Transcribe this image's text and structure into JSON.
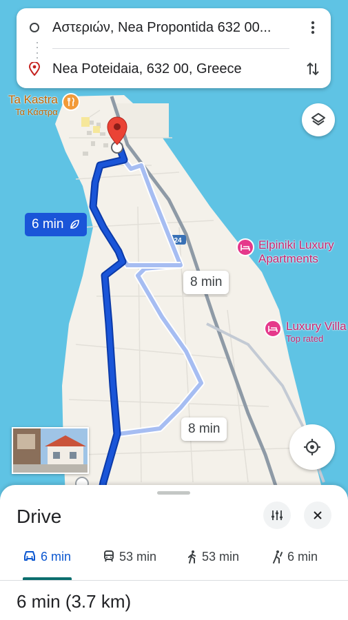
{
  "search": {
    "origin": "Αστεριών, Nea Propontida 632 00...",
    "destination": "Nea Poteidaia, 632 00, Greece"
  },
  "map": {
    "selected_route_time": "6 min",
    "alt_route_time_1": "8 min",
    "alt_route_time_2": "8 min",
    "road_number": "24",
    "poi_kastra_name": "Ta Kastra",
    "poi_kastra_sub": "Τα Κάστρα",
    "poi_elpiniki_line1": "Elpiniki Luxury",
    "poi_elpiniki_line2": "Apartments",
    "poi_luxury_name": "Luxury Villa",
    "poi_luxury_sub": "Top rated"
  },
  "sheet": {
    "title": "Drive",
    "tabs": [
      {
        "icon": "car-icon",
        "label": "6 min"
      },
      {
        "icon": "transit-icon",
        "label": "53 min"
      },
      {
        "icon": "walk-icon",
        "label": "53 min"
      },
      {
        "icon": "ride-icon",
        "label": "6 min"
      }
    ],
    "summary_time": "6 min",
    "summary_distance": "(3.7 km)"
  },
  "colors": {
    "water": "#5fc3e4",
    "land": "#f4f1ea",
    "route_selected": "#1a55d8",
    "route_alt": "#a6bdf2",
    "accent": "#0b57d0",
    "pin": "#ea4335",
    "poi_hotel": "#e5398b",
    "poi_food": "#f29a38"
  }
}
